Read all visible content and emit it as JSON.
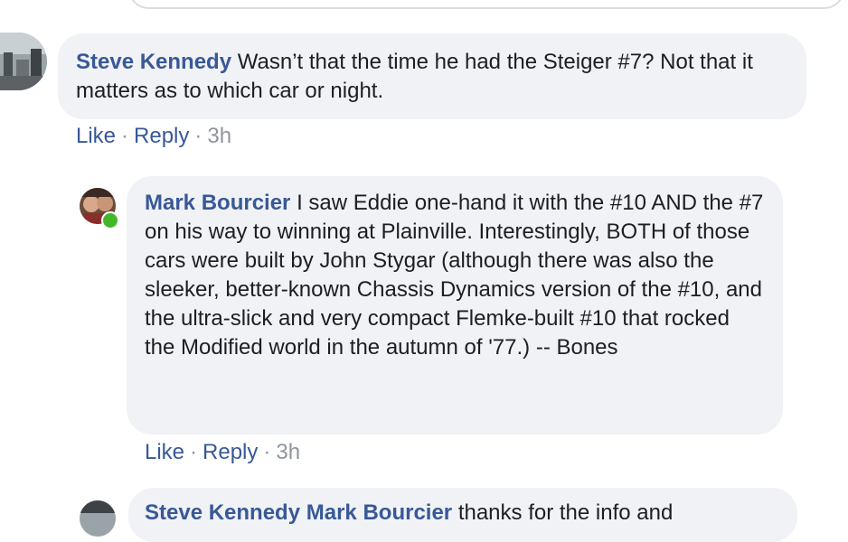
{
  "comment1": {
    "author": "Steve Kennedy",
    "text": "Wasn’t that the time he had the Steiger #7? Not that it matters as to which car or night.",
    "like": "Like",
    "reply": "Reply",
    "dot": "·",
    "time": "3h"
  },
  "comment2": {
    "author": "Mark Bourcier",
    "text": "I saw Eddie one-hand it with the #10 AND the #7 on his way to winning at Plainville. Interestingly, BOTH of those cars were built by John Stygar (although there was also the sleeker, better-known Chassis Dynamics version of the #10, and the ultra-slick and very compact Flemke-built #10 that rocked the Modified world in the autumn of '77.) -- Bones",
    "like": "Like",
    "reply": "Reply",
    "dot": "·",
    "time": "3h"
  },
  "comment3": {
    "author": "Steve Kennedy",
    "mention": "Mark Bourcier",
    "text": "thanks for the info and"
  },
  "colors": {
    "link": "#385898",
    "bubble": "#f0f2f5",
    "meta": "#90949c",
    "online": "#42b72a"
  }
}
